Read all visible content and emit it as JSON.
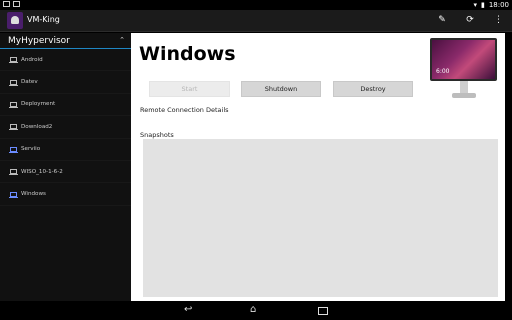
{
  "statusbar": {
    "time": "18:00",
    "icons": [
      "image-icon",
      "cat-icon"
    ]
  },
  "app": {
    "title": "VM-King"
  },
  "actionbar": {
    "icons": [
      "edit-icon",
      "refresh-icon",
      "overflow-menu-icon"
    ]
  },
  "sidebar": {
    "header": "MyHypervisor",
    "items": [
      {
        "label": "Android",
        "active": false
      },
      {
        "label": "Datev",
        "active": false
      },
      {
        "label": "Deployment",
        "active": false
      },
      {
        "label": "Download2",
        "active": false
      },
      {
        "label": "Serviio",
        "active": true
      },
      {
        "label": "WISO_10-1-6-2",
        "active": false
      },
      {
        "label": "Windows",
        "active": true
      }
    ]
  },
  "vm": {
    "title": "Windows",
    "buttons": {
      "start": "Start",
      "shutdown": "Shutdown",
      "destroy": "Destroy"
    },
    "remote_connection_label": "Remote Connection Details",
    "snapshots_label": "Snapshots",
    "preview_clock": "6:00"
  },
  "colors": {
    "accent": "#1f87c4",
    "active_vm_icon": "#6b8cff"
  }
}
